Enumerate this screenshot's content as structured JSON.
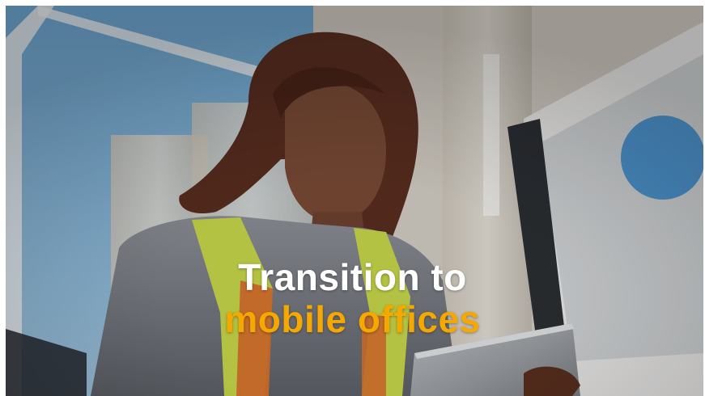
{
  "headline": {
    "line1": "Transition to",
    "line2": "mobile offices"
  },
  "colors": {
    "line1_text": "#ffffff",
    "line2_text": "#f5a800"
  }
}
